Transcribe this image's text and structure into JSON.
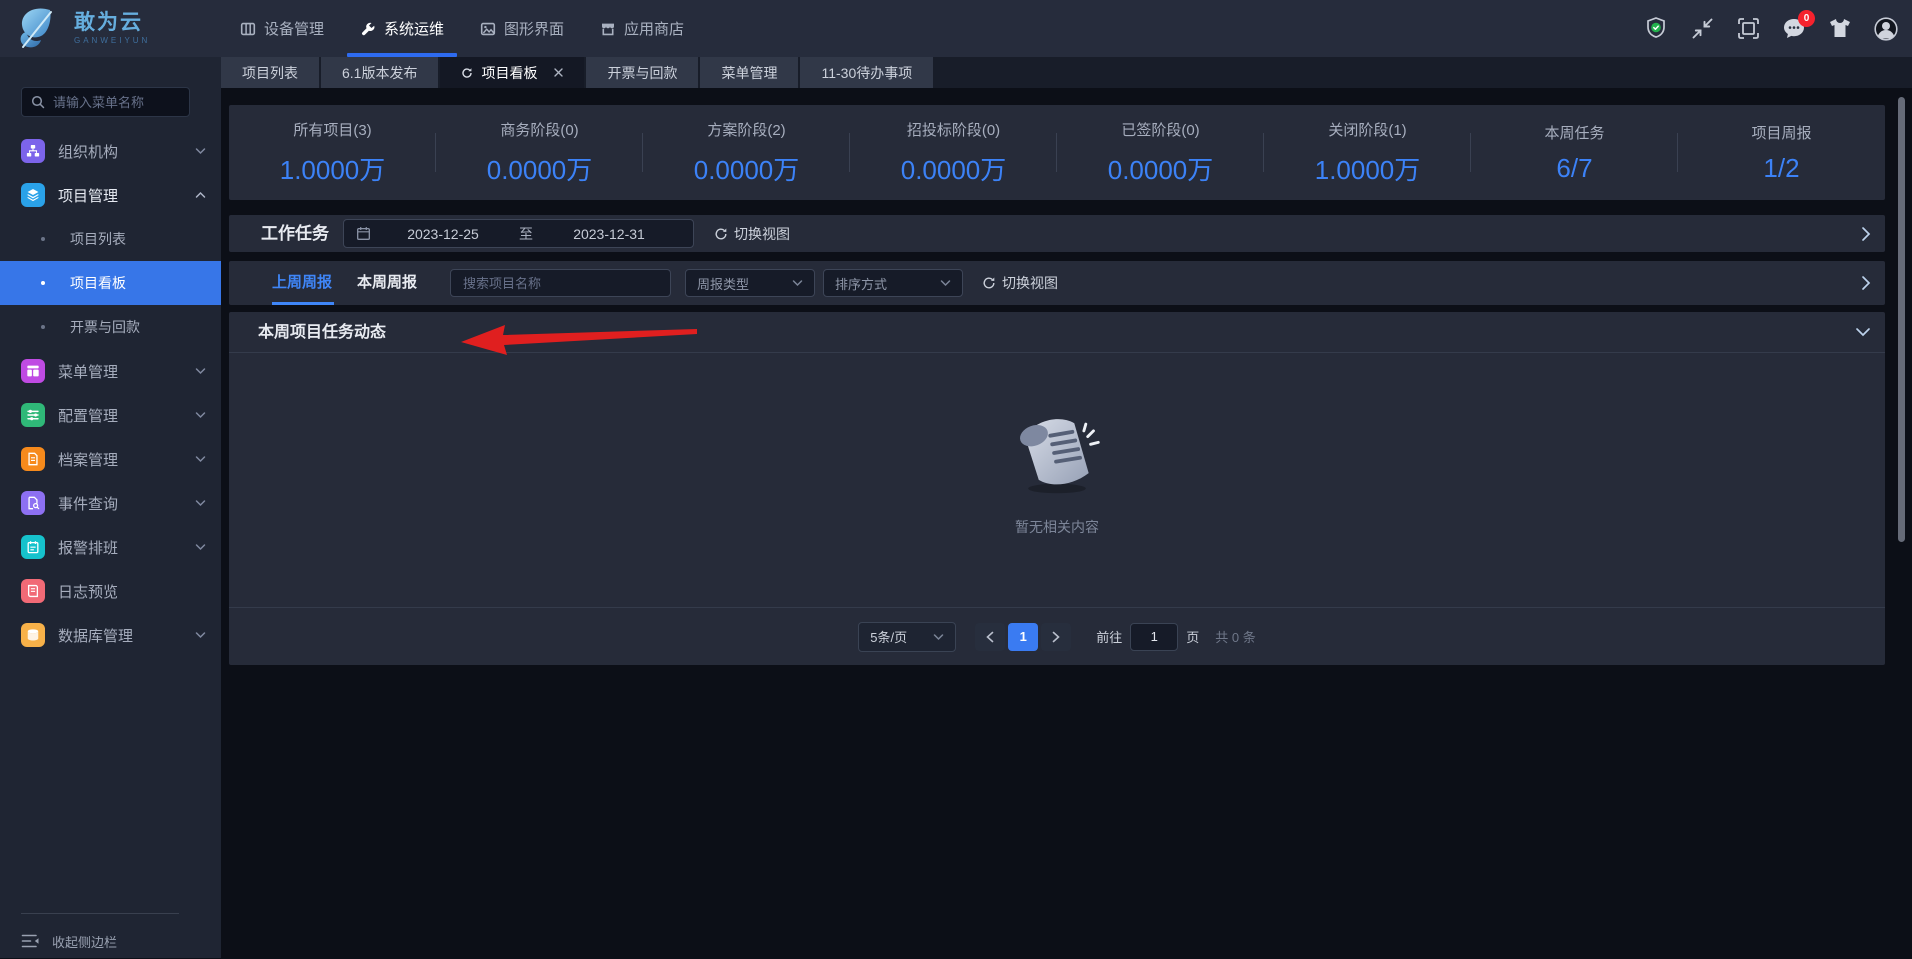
{
  "colors": {
    "accent_blue": "#3a7bf2",
    "stat_value_blue": "#3c82f7",
    "nav_active_underline": "#2e6bf0",
    "sidebar_active_bg": "#3776e8",
    "weekly_tab_underline": "#3f86f8",
    "badge_red": "#f5222d",
    "shield_green": "#23b14d",
    "annotation_arrow_red": "#e01f1f",
    "icon_org": "#7c64ea",
    "icon_project": "#2aa2e9",
    "icon_menu": "#bf4be3",
    "icon_config": "#2fb878",
    "icon_archive": "#f68a1c",
    "icon_event": "#8d70f2",
    "icon_alarm": "#16c2cc",
    "icon_log": "#f16a76",
    "icon_database": "#f7b149"
  },
  "navbar": {
    "brand": {
      "title": "敢为云",
      "subtitle": "GANWEIYUN"
    },
    "menu": [
      {
        "label": "设备管理"
      },
      {
        "label": "系统运维"
      },
      {
        "label": "图形界面"
      },
      {
        "label": "应用商店"
      }
    ],
    "message_badge": "0"
  },
  "tabbar": {
    "tabs": [
      "项目列表",
      "6.1版本发布",
      "项目看板",
      "开票与回款",
      "菜单管理",
      "11-30待办事项"
    ]
  },
  "sidebar": {
    "search_placeholder": "请输入菜单名称",
    "items": [
      {
        "label": "组织机构"
      },
      {
        "label": "项目管理"
      },
      {
        "label": "项目列表"
      },
      {
        "label": "项目看板"
      },
      {
        "label": "开票与回款"
      },
      {
        "label": "菜单管理"
      },
      {
        "label": "配置管理"
      },
      {
        "label": "档案管理"
      },
      {
        "label": "事件查询"
      },
      {
        "label": "报警排班"
      },
      {
        "label": "日志预览"
      },
      {
        "label": "数据库管理"
      }
    ],
    "collapse_label": "收起侧边栏"
  },
  "stats": {
    "items": [
      {
        "label": "所有项目(3)",
        "value": "1.0000万"
      },
      {
        "label": "商务阶段(0)",
        "value": "0.0000万"
      },
      {
        "label": "方案阶段(2)",
        "value": "0.0000万"
      },
      {
        "label": "招投标阶段(0)",
        "value": "0.0000万"
      },
      {
        "label": "已签阶段(0)",
        "value": "0.0000万"
      },
      {
        "label": "关闭阶段(1)",
        "value": "1.0000万"
      },
      {
        "label": "本周任务",
        "value": "6/7"
      },
      {
        "label": "项目周报",
        "value": "1/2"
      }
    ]
  },
  "work_task": {
    "title": "工作任务",
    "date_start": "2023-12-25",
    "date_separator": "至",
    "date_end": "2023-12-31",
    "switch_view": "切换视图"
  },
  "weekly": {
    "tab_last_week": "上周周报",
    "tab_this_week": "本周周报",
    "search_placeholder": "搜索项目名称",
    "type_placeholder": "周报类型",
    "sort_placeholder": "排序方式",
    "switch_view": "切换视图"
  },
  "dynamics": {
    "title": "本周项目任务动态",
    "empty_text": "暂无相关内容"
  },
  "pagination": {
    "page_size": "5条/页",
    "current_page": "1",
    "goto_label": "前往",
    "goto_value": "1",
    "unit_label": "页",
    "total_label": "共 0 条"
  }
}
